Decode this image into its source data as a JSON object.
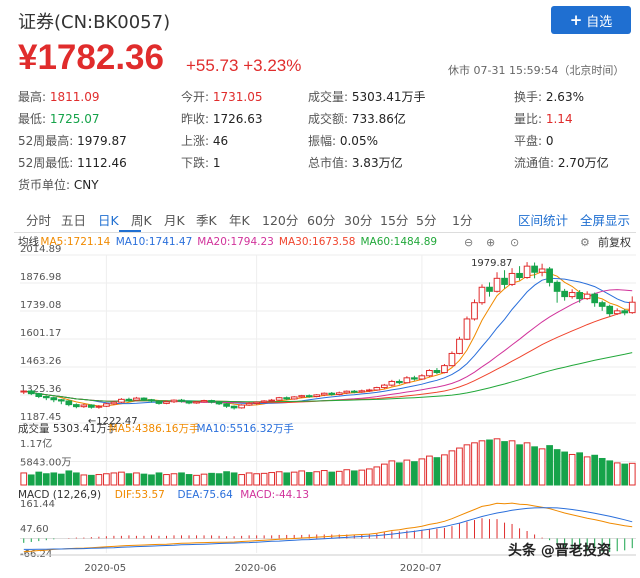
{
  "header": {
    "title": "证券(CN:BK0057)",
    "add_label": "自选",
    "price": "¥1782.36",
    "change": "+55.73",
    "change_pct": "+3.23%",
    "status": "休市 07-31 15:59:54（北京时间）"
  },
  "stats": [
    {
      "k": "最高:",
      "v": "1811.09",
      "tone": "red"
    },
    {
      "k": "今开:",
      "v": "1731.05",
      "tone": "red"
    },
    {
      "k": "成交量:",
      "v": "5303.41万手",
      "tone": ""
    },
    {
      "k": "换手:",
      "v": "2.63%",
      "tone": ""
    },
    {
      "k": "最低:",
      "v": "1725.07",
      "tone": "green"
    },
    {
      "k": "昨收:",
      "v": "1726.63",
      "tone": ""
    },
    {
      "k": "成交额:",
      "v": "733.86亿",
      "tone": ""
    },
    {
      "k": "量比:",
      "v": "1.14",
      "tone": "red"
    },
    {
      "k": "52周最高:",
      "v": "1979.87",
      "tone": ""
    },
    {
      "k": "上涨:",
      "v": "46",
      "tone": ""
    },
    {
      "k": "振幅:",
      "v": "0.05%",
      "tone": ""
    },
    {
      "k": "平盘:",
      "v": "0",
      "tone": ""
    },
    {
      "k": "52周最低:",
      "v": "1112.46",
      "tone": ""
    },
    {
      "k": "下跌:",
      "v": "1",
      "tone": ""
    },
    {
      "k": "总市值:",
      "v": "3.83万亿",
      "tone": ""
    },
    {
      "k": "流通值:",
      "v": "2.70万亿",
      "tone": ""
    },
    {
      "k": "货币单位:",
      "v": "CNY",
      "tone": ""
    }
  ],
  "tabs": [
    "分时",
    "五日",
    "日K",
    "周K",
    "月K",
    "季K",
    "年K",
    "120分",
    "60分",
    "30分",
    "15分",
    "5分",
    "1分"
  ],
  "active_tab": "日K",
  "tab_links": [
    "区间统计",
    "全屏显示"
  ],
  "ma_legend": {
    "label": "均线",
    "items": [
      {
        "text": "MA5:1721.14",
        "color": "#f08a00"
      },
      {
        "text": "MA10:1741.47",
        "color": "#2a6fdb"
      },
      {
        "text": "MA20:1794.23",
        "color": "#d1339b"
      },
      {
        "text": "MA30:1673.58",
        "color": "#f0442d"
      },
      {
        "text": "MA60:1484.89",
        "color": "#22a83a"
      }
    ]
  },
  "restore": "前复权",
  "vol_legend": {
    "label": "成交量 5303.41万手",
    "items": [
      {
        "text": "MA5:4386.16万手",
        "color": "#f08a00"
      },
      {
        "text": "MA10:5516.32万手",
        "color": "#2a6fdb"
      }
    ]
  },
  "macd_legend": {
    "label": "MACD (12,26,9)",
    "items": [
      {
        "text": "DIF:53.57",
        "color": "#f08a00"
      },
      {
        "text": "DEA:75.64",
        "color": "#2a6fdb"
      },
      {
        "text": "MACD:-44.13",
        "color": "#d1339b"
      }
    ]
  },
  "watermark": "头条 @晋老投资",
  "colors": {
    "up": "#e02c2c",
    "down": "#16a34a",
    "accent": "#1f6fd1"
  },
  "chart_data": {
    "type": "candlestick",
    "price_axis_ticks": [
      "2014.89",
      "1876.98",
      "1739.08",
      "1601.17",
      "1463.26",
      "1325.36",
      "1187.45"
    ],
    "price_annotations": [
      {
        "label": "1979.87"
      },
      {
        "label": "1222.47"
      }
    ],
    "volume_axis_ticks": [
      "1.17亿",
      "5843.00万"
    ],
    "macd_axis_ticks": [
      "161.44",
      "47.60",
      "-66.24"
    ],
    "x_axis_ticks": [
      "2020-05",
      "2020-06",
      "2020-07"
    ],
    "candles": [
      [
        1340,
        1345,
        1330,
        1348
      ],
      [
        1345,
        1332,
        1325,
        1350
      ],
      [
        1332,
        1318,
        1310,
        1336
      ],
      [
        1318,
        1312,
        1300,
        1322
      ],
      [
        1312,
        1302,
        1290,
        1316
      ],
      [
        1302,
        1296,
        1280,
        1306
      ],
      [
        1296,
        1278,
        1270,
        1300
      ],
      [
        1278,
        1268,
        1260,
        1284
      ],
      [
        1268,
        1276,
        1262,
        1282
      ],
      [
        1276,
        1265,
        1258,
        1280
      ],
      [
        1265,
        1270,
        1258,
        1276
      ],
      [
        1270,
        1282,
        1266,
        1288
      ],
      [
        1282,
        1290,
        1276,
        1296
      ],
      [
        1290,
        1304,
        1286,
        1310
      ],
      [
        1304,
        1300,
        1292,
        1312
      ],
      [
        1300,
        1310,
        1296,
        1316
      ],
      [
        1310,
        1302,
        1296,
        1314
      ],
      [
        1302,
        1296,
        1288,
        1306
      ],
      [
        1296,
        1284,
        1278,
        1300
      ],
      [
        1284,
        1292,
        1280,
        1298
      ],
      [
        1292,
        1300,
        1286,
        1304
      ],
      [
        1300,
        1294,
        1288,
        1306
      ],
      [
        1294,
        1286,
        1280,
        1298
      ],
      [
        1286,
        1292,
        1282,
        1296
      ],
      [
        1292,
        1298,
        1288,
        1302
      ],
      [
        1298,
        1290,
        1284,
        1302
      ],
      [
        1290,
        1282,
        1276,
        1294
      ],
      [
        1282,
        1270,
        1262,
        1286
      ],
      [
        1270,
        1262,
        1254,
        1274
      ],
      [
        1262,
        1276,
        1258,
        1280
      ],
      [
        1276,
        1284,
        1272,
        1290
      ],
      [
        1284,
        1290,
        1278,
        1294
      ],
      [
        1290,
        1296,
        1286,
        1300
      ],
      [
        1296,
        1300,
        1292,
        1306
      ],
      [
        1300,
        1312,
        1296,
        1316
      ],
      [
        1312,
        1306,
        1300,
        1318
      ],
      [
        1306,
        1316,
        1302,
        1320
      ],
      [
        1316,
        1322,
        1310,
        1326
      ],
      [
        1322,
        1318,
        1312,
        1328
      ],
      [
        1318,
        1326,
        1314,
        1330
      ],
      [
        1326,
        1334,
        1320,
        1338
      ],
      [
        1334,
        1328,
        1322,
        1340
      ],
      [
        1328,
        1336,
        1324,
        1342
      ],
      [
        1336,
        1344,
        1330,
        1348
      ],
      [
        1344,
        1340,
        1334,
        1350
      ],
      [
        1340,
        1346,
        1336,
        1352
      ],
      [
        1346,
        1350,
        1340,
        1356
      ],
      [
        1350,
        1362,
        1346,
        1366
      ],
      [
        1362,
        1374,
        1356,
        1380
      ],
      [
        1374,
        1392,
        1368,
        1400
      ],
      [
        1392,
        1386,
        1378,
        1402
      ],
      [
        1386,
        1410,
        1382,
        1418
      ],
      [
        1410,
        1404,
        1396,
        1420
      ],
      [
        1404,
        1420,
        1400,
        1428
      ],
      [
        1420,
        1446,
        1414,
        1452
      ],
      [
        1446,
        1436,
        1428,
        1458
      ],
      [
        1436,
        1470,
        1432,
        1478
      ],
      [
        1470,
        1530,
        1466,
        1540
      ],
      [
        1530,
        1600,
        1526,
        1612
      ],
      [
        1600,
        1700,
        1596,
        1712
      ],
      [
        1700,
        1780,
        1692,
        1796
      ],
      [
        1780,
        1856,
        1770,
        1870
      ],
      [
        1856,
        1836,
        1810,
        1880
      ],
      [
        1836,
        1900,
        1830,
        1930
      ],
      [
        1900,
        1870,
        1850,
        1940
      ],
      [
        1870,
        1924,
        1862,
        1950
      ],
      [
        1924,
        1904,
        1890,
        1960
      ],
      [
        1904,
        1960,
        1898,
        1979.87
      ],
      [
        1960,
        1930,
        1900,
        1978
      ],
      [
        1930,
        1946,
        1910,
        1972
      ],
      [
        1946,
        1880,
        1860,
        1956
      ],
      [
        1880,
        1836,
        1780,
        1890
      ],
      [
        1836,
        1810,
        1790,
        1848
      ],
      [
        1810,
        1830,
        1800,
        1846
      ],
      [
        1830,
        1800,
        1780,
        1842
      ],
      [
        1800,
        1822,
        1794,
        1836
      ],
      [
        1822,
        1780,
        1760,
        1830
      ],
      [
        1780,
        1762,
        1740,
        1790
      ],
      [
        1762,
        1726,
        1712,
        1770
      ],
      [
        1726,
        1740,
        1720,
        1752
      ],
      [
        1740,
        1730,
        1718,
        1748
      ],
      [
        1731,
        1782.36,
        1725.07,
        1811.09
      ]
    ],
    "volumes": [
      0.3,
      0.25,
      0.32,
      0.28,
      0.3,
      0.27,
      0.35,
      0.3,
      0.25,
      0.24,
      0.26,
      0.28,
      0.3,
      0.32,
      0.28,
      0.3,
      0.27,
      0.25,
      0.3,
      0.26,
      0.28,
      0.3,
      0.26,
      0.24,
      0.27,
      0.29,
      0.28,
      0.33,
      0.3,
      0.26,
      0.3,
      0.28,
      0.29,
      0.31,
      0.33,
      0.3,
      0.32,
      0.35,
      0.31,
      0.33,
      0.36,
      0.32,
      0.34,
      0.38,
      0.35,
      0.37,
      0.4,
      0.45,
      0.52,
      0.6,
      0.55,
      0.62,
      0.58,
      0.65,
      0.72,
      0.68,
      0.75,
      0.85,
      0.92,
      1.0,
      1.05,
      1.1,
      1.12,
      1.15,
      1.08,
      1.1,
      1.0,
      1.05,
      0.95,
      0.9,
      0.98,
      0.88,
      0.82,
      0.76,
      0.8,
      0.7,
      0.74,
      0.66,
      0.6,
      0.55,
      0.52,
      0.54
    ],
    "macd_dif": [
      -60,
      -58,
      -55,
      -53,
      -50,
      -48,
      -46,
      -45,
      -44,
      -42,
      -40,
      -38,
      -36,
      -34,
      -32,
      -31,
      -30,
      -28,
      -27,
      -26,
      -24,
      -22,
      -21,
      -20,
      -19,
      -18,
      -17,
      -17,
      -16,
      -14,
      -12,
      -10,
      -8,
      -6,
      -4,
      -2,
      0,
      2,
      4,
      6,
      8,
      10,
      12,
      14,
      16,
      18,
      20,
      24,
      30,
      36,
      40,
      46,
      50,
      56,
      64,
      70,
      78,
      90,
      104,
      118,
      132,
      146,
      152,
      160,
      158,
      161,
      156,
      154,
      148,
      142,
      136,
      126,
      116,
      108,
      100,
      92,
      86,
      78,
      70,
      64,
      58,
      53.57
    ],
    "macd_dea": [
      -50,
      -50,
      -49,
      -49,
      -48,
      -48,
      -47,
      -47,
      -46,
      -45,
      -44,
      -43,
      -42,
      -40,
      -39,
      -37,
      -36,
      -35,
      -33,
      -32,
      -31,
      -29,
      -28,
      -27,
      -26,
      -25,
      -23,
      -22,
      -21,
      -20,
      -19,
      -17,
      -15,
      -13,
      -12,
      -10,
      -8,
      -6,
      -5,
      -3,
      -1,
      1,
      3,
      5,
      7,
      9,
      11,
      13,
      16,
      20,
      24,
      28,
      32,
      37,
      42,
      48,
      54,
      62,
      70,
      80,
      90,
      100,
      108,
      116,
      122,
      128,
      133,
      137,
      139,
      140,
      140,
      139,
      136,
      132,
      127,
      121,
      115,
      108,
      101,
      93,
      85,
      75.64
    ]
  }
}
